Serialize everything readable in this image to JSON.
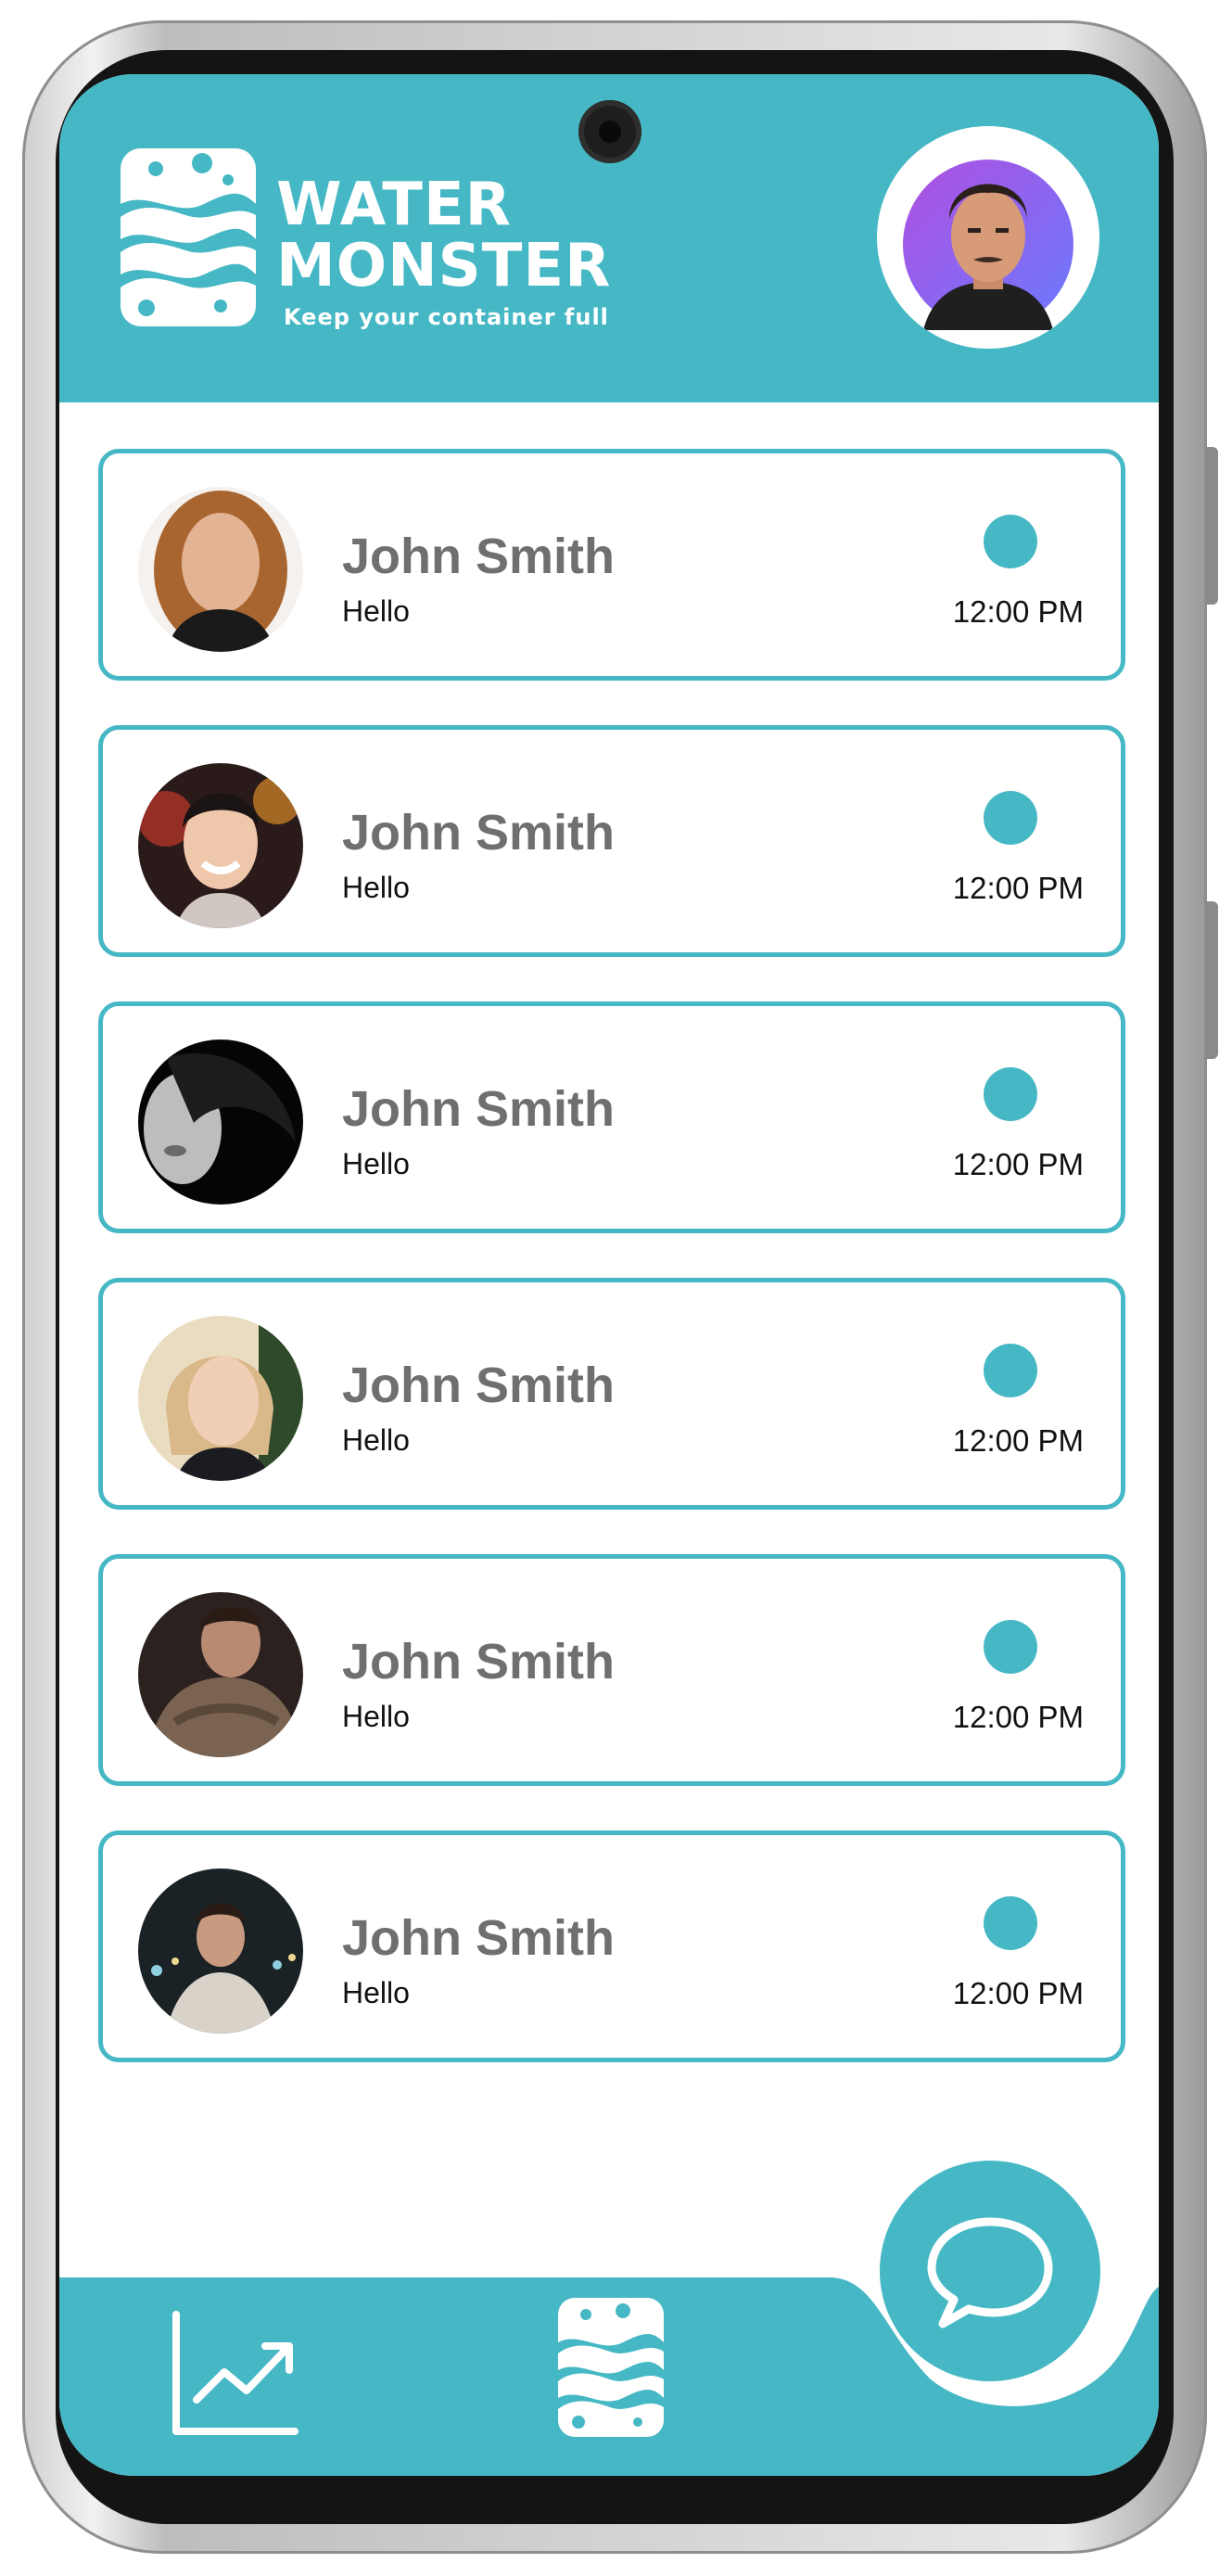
{
  "app": {
    "brand_line_1": "WATER",
    "brand_line_2": "MONSTER",
    "tagline": "Keep your container full"
  },
  "colors": {
    "accent": "#46b8c5",
    "name_text": "#6f6f6f",
    "body_text": "#111111"
  },
  "chats": [
    {
      "name": "John Smith",
      "message": "Hello",
      "time": "12:00 PM"
    },
    {
      "name": "John Smith",
      "message": "Hello",
      "time": "12:00 PM"
    },
    {
      "name": "John Smith",
      "message": "Hello",
      "time": "12:00 PM"
    },
    {
      "name": "John Smith",
      "message": "Hello",
      "time": "12:00 PM"
    },
    {
      "name": "John Smith",
      "message": "Hello",
      "time": "12:00 PM"
    },
    {
      "name": "John Smith",
      "message": "Hello",
      "time": "12:00 PM"
    }
  ],
  "nav": {
    "icons": [
      "chart-trend-icon",
      "water-monster-logo-icon",
      "chat-bubble-icon"
    ]
  }
}
